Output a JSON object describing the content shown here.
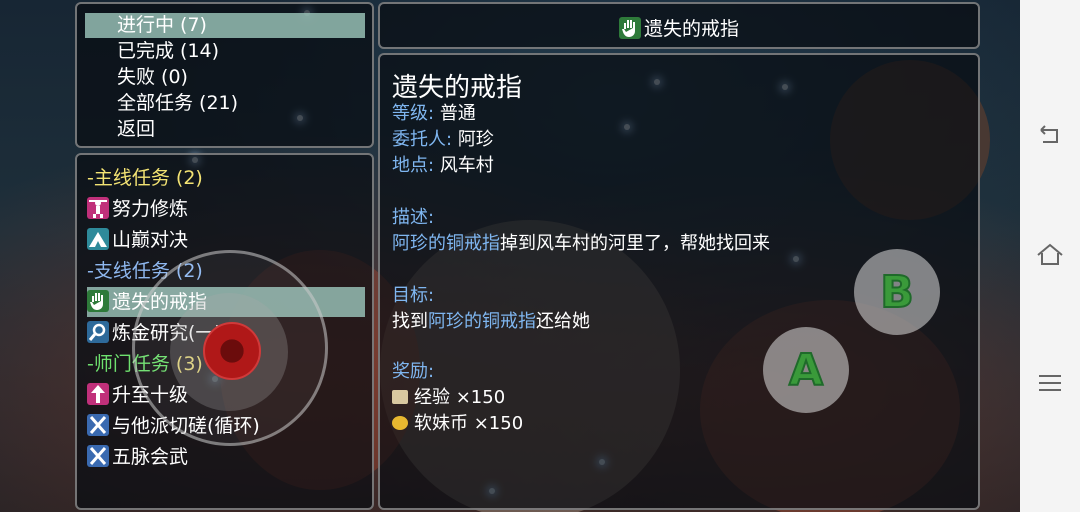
{
  "filters": [
    "进行中 (7)",
    "已完成 (14)",
    "失败 (0)",
    "全部任务 (21)",
    "返回"
  ],
  "selected_filter": "进行中 (7)",
  "quest_list": {
    "main_category": "-主线任务",
    "main_count": "(2)",
    "main_quests": [
      "努力修炼",
      "山巅对决"
    ],
    "side_category": "-支线任务",
    "side_count": "(2)",
    "side_quests": [
      "遗失的戒指",
      "炼金研究(一)"
    ],
    "sect_category": "-师门任务",
    "sect_count": "(3)",
    "sect_quests": [
      "升至十级",
      "与他派切磋(循环)",
      "五脉会武"
    ],
    "selected": "遗失的戒指"
  },
  "header": {
    "title": "遗失的戒指"
  },
  "detail": {
    "title": "遗失的戒指",
    "grade_label": "等级:",
    "grade_value": "普通",
    "client_label": "委托人:",
    "client_value": "阿珍",
    "location_label": "地点:",
    "location_value": "风车村",
    "desc_label": "描述:",
    "desc_highlight": "阿珍的铜戒指",
    "desc_rest": "掉到风车村的河里了，帮她找回来",
    "goal_label": "目标:",
    "goal_prefix": "找到",
    "goal_highlight": "阿珍的铜戒指",
    "goal_suffix": "还给她",
    "reward_label": "奖励:",
    "rewards": [
      "经验 ×150",
      "软妹币 ×150"
    ]
  },
  "controls": {
    "a_label": "A",
    "b_label": "B"
  },
  "colors": {
    "selected_bg": "#96beb4",
    "category_yellow": "#f3e373",
    "category_green": "#6ee06e",
    "highlight_blue": "#7fb6f0"
  }
}
